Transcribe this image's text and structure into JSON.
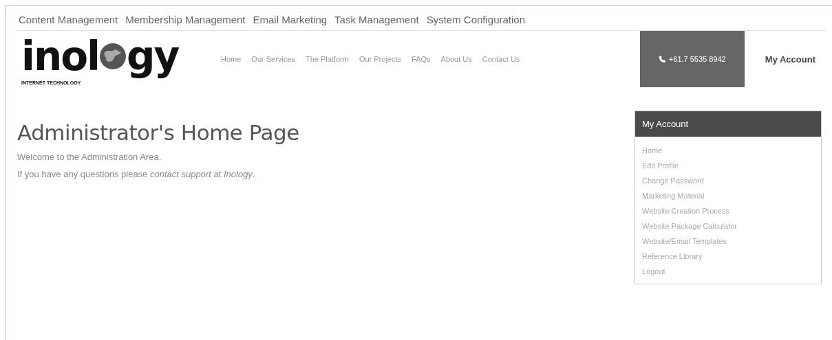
{
  "admin_menu": [
    "Content Management",
    "Membership Management",
    "Email Marketing",
    "Task Management",
    "System Configuration"
  ],
  "logo": {
    "left": "inol",
    "right": "gy",
    "tagline": "INTERNET TECHNOLOGY"
  },
  "nav": [
    "Home",
    "Our Services",
    "The Platform",
    "Our Projects",
    "FAQs",
    "About Us",
    "Contact Us"
  ],
  "phone": "+61.7 5535 8942",
  "account_link": "My Account",
  "page": {
    "title": "Administrator's Home Page",
    "paragraphs": [
      "Welcome to the Administration Area.",
      "If you have any questions please *contact support* at *Inology*."
    ]
  },
  "sidebar": {
    "title": "My Account",
    "items": [
      "Home",
      "Edit Profile",
      "Change Password",
      "Marketing Material",
      "Website Creation Process",
      "Website Package Calculator",
      "Website/Email Templates",
      "Reference Library",
      "Logout"
    ]
  }
}
